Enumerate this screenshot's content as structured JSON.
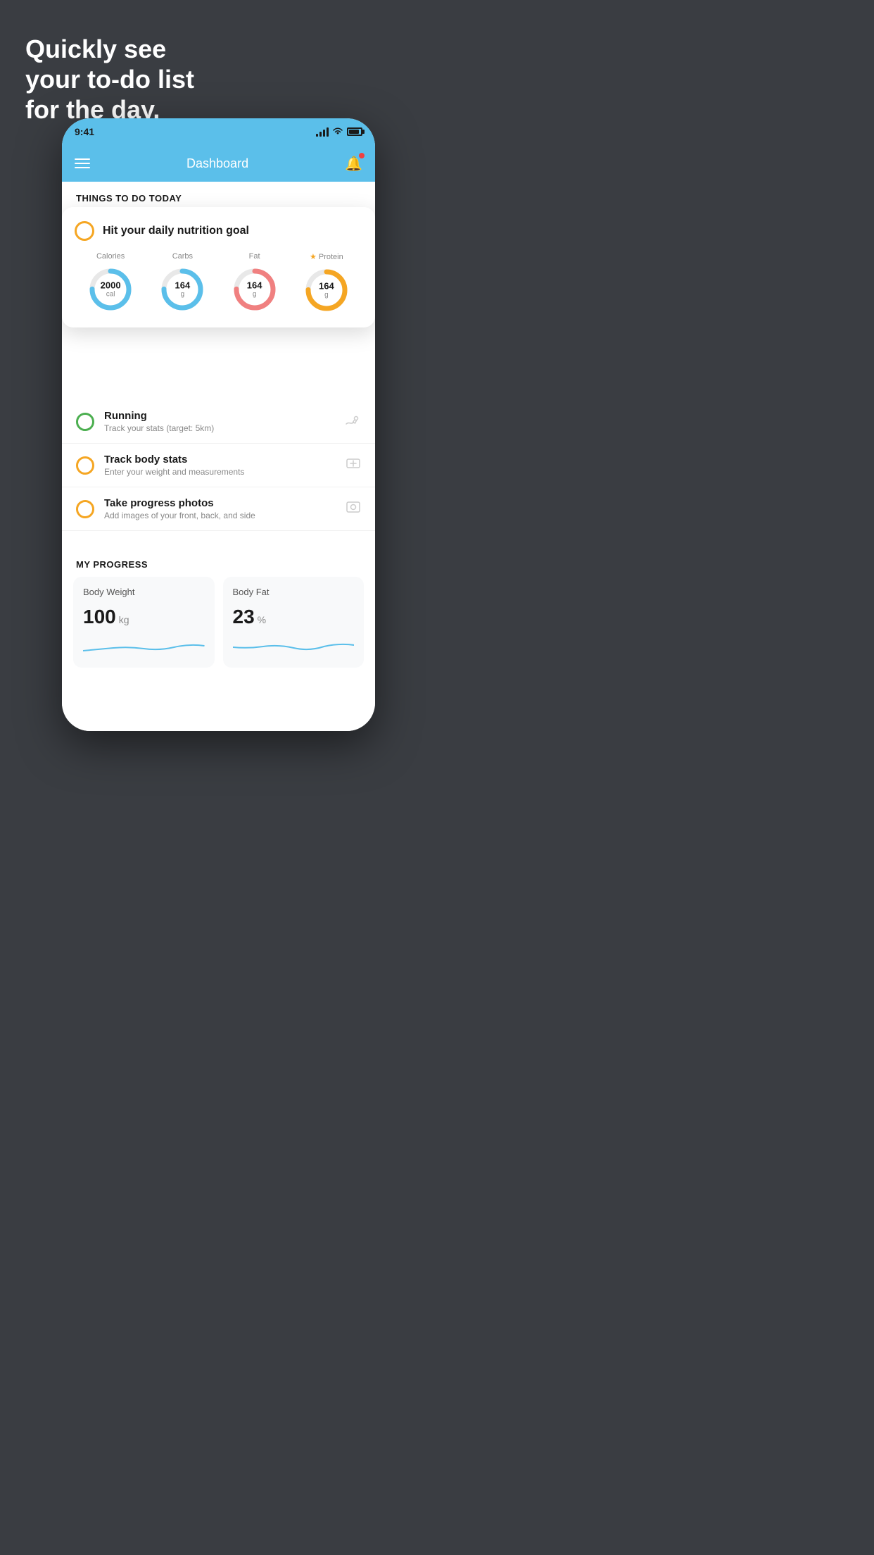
{
  "background": {
    "headline_line1": "Quickly see",
    "headline_line2": "your to-do list",
    "headline_line3": "for the day."
  },
  "status_bar": {
    "time": "9:41"
  },
  "app_header": {
    "title": "Dashboard"
  },
  "things_section": {
    "label": "THINGS TO DO TODAY"
  },
  "nutrition_card": {
    "title": "Hit your daily nutrition goal",
    "items": [
      {
        "label": "Calories",
        "value": "2000",
        "unit": "cal",
        "color": "blue",
        "star": false
      },
      {
        "label": "Carbs",
        "value": "164",
        "unit": "g",
        "color": "blue",
        "star": false
      },
      {
        "label": "Fat",
        "value": "164",
        "unit": "g",
        "color": "pink",
        "star": false
      },
      {
        "label": "Protein",
        "value": "164",
        "unit": "g",
        "color": "yellow",
        "star": true
      }
    ]
  },
  "todo_items": [
    {
      "title": "Running",
      "subtitle": "Track your stats (target: 5km)",
      "circle": "green",
      "icon": "👟"
    },
    {
      "title": "Track body stats",
      "subtitle": "Enter your weight and measurements",
      "circle": "yellow",
      "icon": "⊞"
    },
    {
      "title": "Take progress photos",
      "subtitle": "Add images of your front, back, and side",
      "circle": "yellow",
      "icon": "👤"
    }
  ],
  "progress_section": {
    "label": "MY PROGRESS",
    "cards": [
      {
        "title": "Body Weight",
        "value": "100",
        "unit": "kg"
      },
      {
        "title": "Body Fat",
        "value": "23",
        "unit": "%"
      }
    ]
  }
}
